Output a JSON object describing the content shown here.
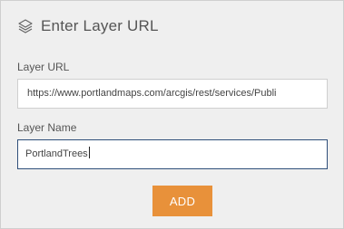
{
  "panel": {
    "title": "Enter Layer URL",
    "icon": "layers-icon"
  },
  "fields": {
    "url": {
      "label": "Layer URL",
      "value": "https://www.portlandmaps.com/arcgis/rest/services/Publi"
    },
    "name": {
      "label": "Layer Name",
      "value": "PortlandTrees"
    }
  },
  "actions": {
    "add_label": "ADD"
  },
  "colors": {
    "accent": "#e8913a",
    "focus_border": "#2f4f7a",
    "background": "#efefef"
  }
}
